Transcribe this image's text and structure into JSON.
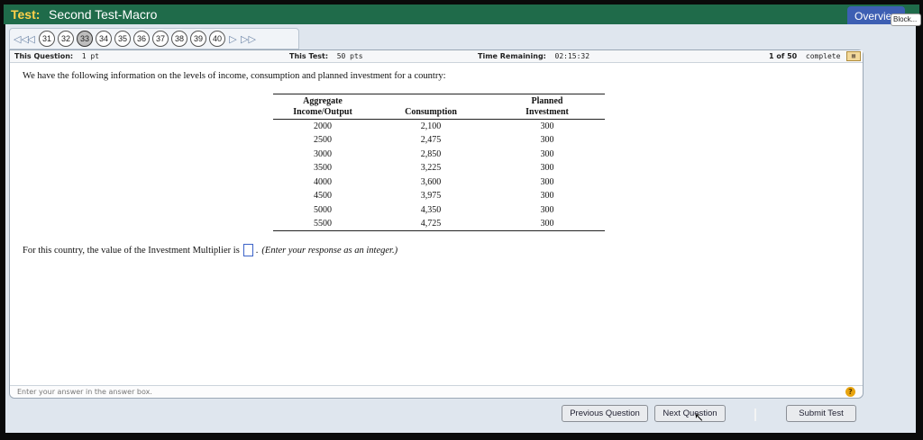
{
  "titlebar": {
    "label": "Test:",
    "title": "Second Test-Macro",
    "overview_button": "Overview",
    "tooltip": "Block..."
  },
  "nav": {
    "first_icon": "double-left-arrow-icon",
    "prev_icon": "left-arrow-icon",
    "next_icon": "right-arrow-icon",
    "last_icon": "double-right-arrow-icon",
    "questions": [
      "31",
      "32",
      "33",
      "34",
      "35",
      "36",
      "37",
      "38",
      "39",
      "40"
    ],
    "current": "33"
  },
  "info_bar": {
    "question_label": "This Question:",
    "question_value": "1 pt",
    "test_label": "This Test:",
    "test_value": "50 pts",
    "time_label": "Time Remaining:",
    "time_value": "02:15:32",
    "progress_count": "1 of 50",
    "progress_text": "complete"
  },
  "question": {
    "intro": "We have the following information on the levels of income, consumption and planned investment for a country:",
    "table": {
      "headers": [
        [
          "Aggregate",
          "Income/Output"
        ],
        [
          "",
          "Consumption"
        ],
        [
          "Planned",
          "Investment"
        ]
      ],
      "rows": [
        [
          "2000",
          "2,100",
          "300"
        ],
        [
          "2500",
          "2,475",
          "300"
        ],
        [
          "3000",
          "2,850",
          "300"
        ],
        [
          "3500",
          "3,225",
          "300"
        ],
        [
          "4000",
          "3,600",
          "300"
        ],
        [
          "4500",
          "3,975",
          "300"
        ],
        [
          "5000",
          "4,350",
          "300"
        ],
        [
          "5500",
          "4,725",
          "300"
        ]
      ]
    },
    "prompt_before": "For this country, the value of the Investment Multiplier is",
    "prompt_after": ".",
    "answer_value": "",
    "hint": "(Enter your response as an integer.)"
  },
  "status": {
    "text": "Enter your answer in the answer box.",
    "help": "?"
  },
  "buttons": {
    "previous": "Previous Question",
    "next": "Next Question",
    "submit": "Submit Test"
  }
}
